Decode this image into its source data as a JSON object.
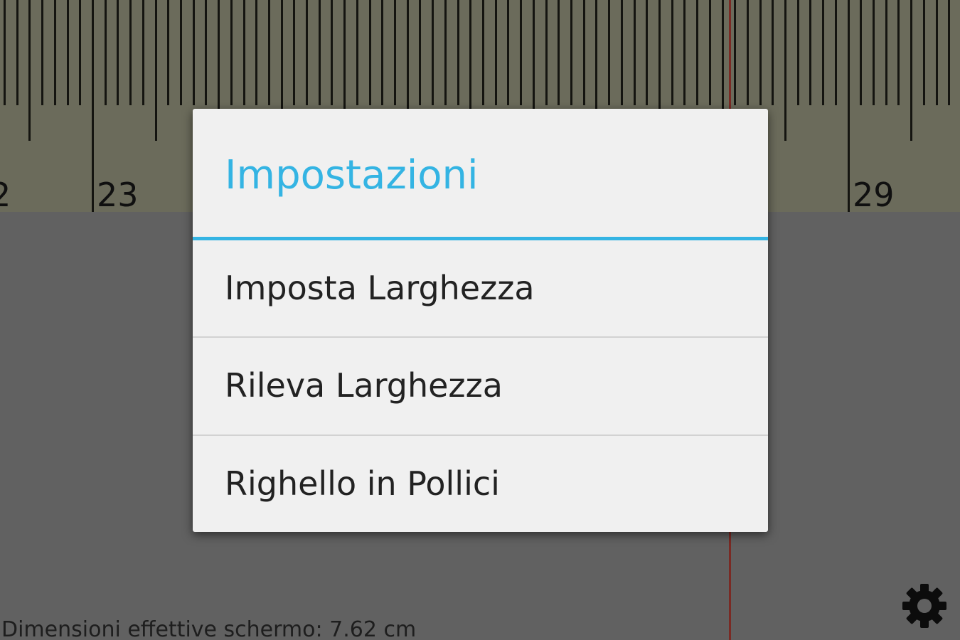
{
  "ruler": {
    "unit": "cm",
    "labels": [
      "2",
      "23",
      "29"
    ],
    "background": "#6b6b5b"
  },
  "dialog": {
    "title": "Impostazioni",
    "accent_color": "#34b4e3",
    "items": [
      {
        "label": "Imposta Larghezza"
      },
      {
        "label": "Rileva Larghezza"
      },
      {
        "label": "Righello in Pollici"
      }
    ]
  },
  "footer": {
    "screen_size_text": "Dimensioni effettive schermo: 7.62 cm"
  },
  "icons": {
    "settings": "gear-icon"
  }
}
